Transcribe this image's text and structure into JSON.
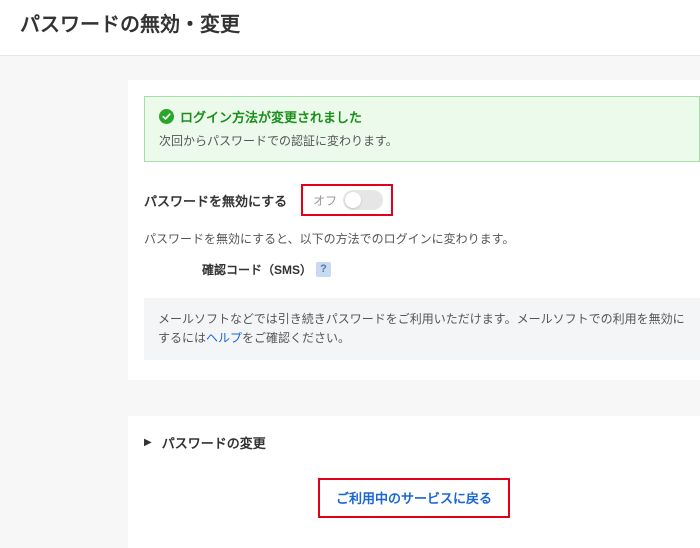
{
  "pageTitle": "パスワードの無効・変更",
  "success": {
    "title": "ログイン方法が変更されました",
    "sub": "次回からパスワードでの認証に変わります。"
  },
  "toggle": {
    "label": "パスワードを無効にする",
    "stateText": "オフ"
  },
  "desc": "パスワードを無効にすると、以下の方法でのログインに変わります。",
  "sms": {
    "label": "確認コード（SMS）",
    "helpGlyph": "?"
  },
  "info": {
    "text1": "メールソフトなどでは引き続きパスワードをご利用いただけます。メールソフトでの利用を無効にするには",
    "helpLink": "ヘルプ",
    "text2": "をご確認ください。"
  },
  "pwChange": {
    "label": "パスワードの変更"
  },
  "returnLink": "ご利用中のサービスに戻る"
}
